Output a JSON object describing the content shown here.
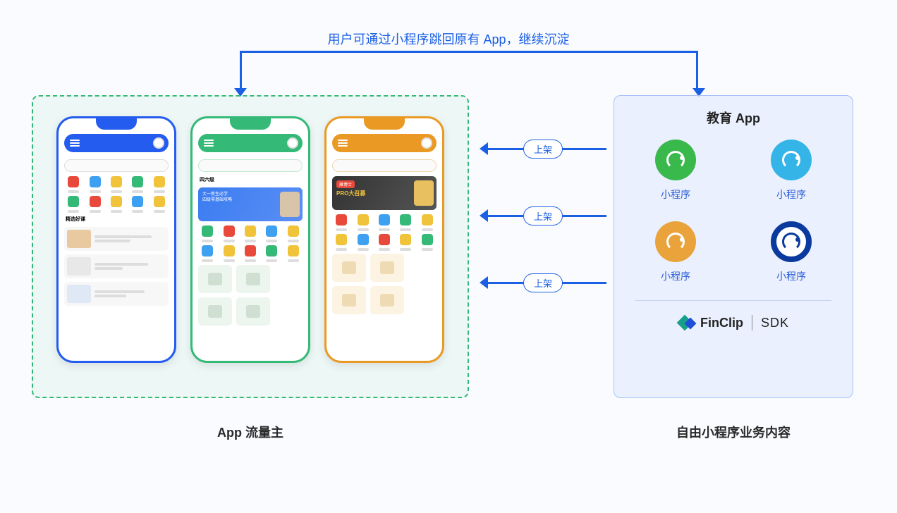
{
  "topLabel": "用户可通过小程序跳回原有 App，继续沉淀",
  "leftCaption": "App 流量主",
  "rightCaption": "自由小程序业务内容",
  "rightPanel": {
    "title": "教育 App",
    "items": [
      {
        "label": "小程序",
        "color": "green"
      },
      {
        "label": "小程序",
        "color": "teal"
      },
      {
        "label": "小程序",
        "color": "orange"
      },
      {
        "label": "小程序",
        "color": "navy"
      }
    ],
    "brand": "FinClip",
    "sdk": "SDK"
  },
  "arrows": [
    {
      "label": "上架"
    },
    {
      "label": "上架"
    },
    {
      "label": "上架"
    }
  ],
  "phones": {
    "blue": {
      "sectionTitle": "精选好课"
    },
    "green": {
      "tab": "四六级",
      "bannerLine1": "大一新生必学",
      "bannerLine2": "四级零基础攻略"
    },
    "orange": {
      "bannerTag": "雁博士",
      "bannerTitle": "PRO大召募"
    }
  }
}
